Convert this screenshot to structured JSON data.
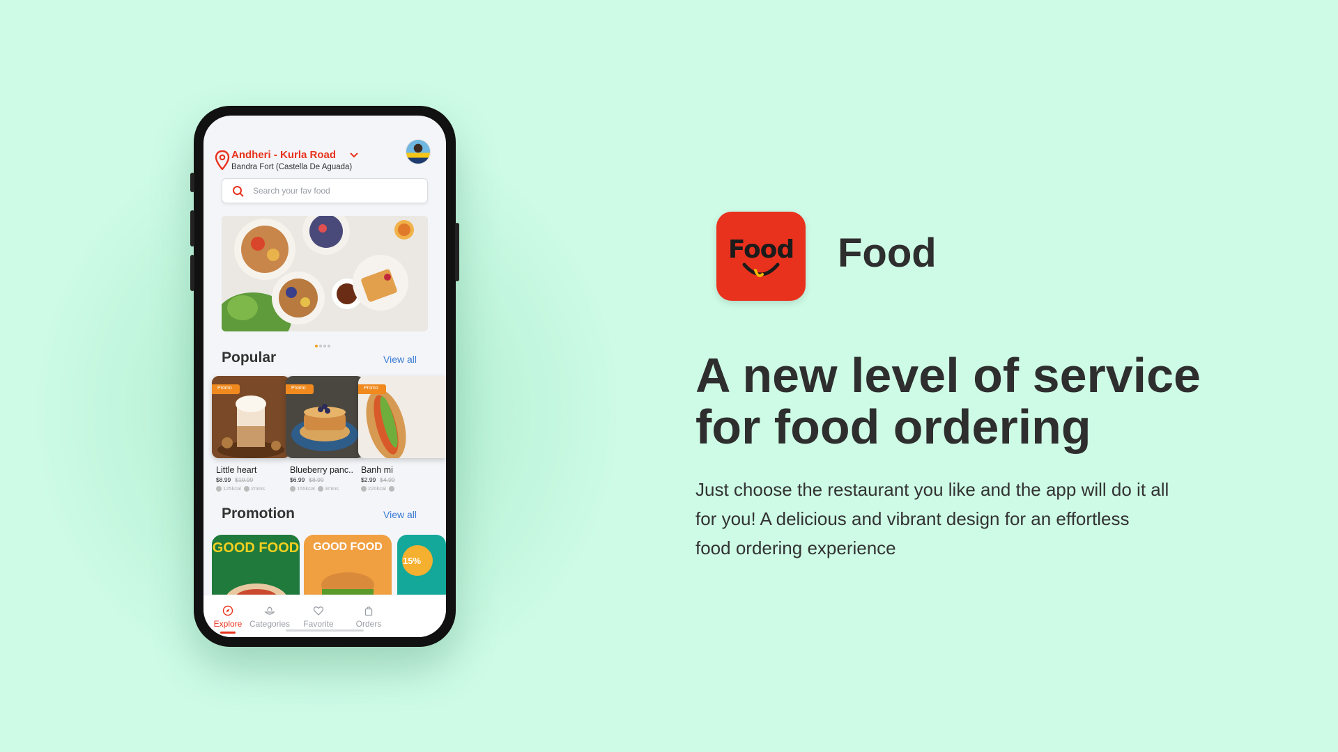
{
  "app": {
    "name": "Food",
    "icon_text": "Food",
    "headline": "A new level of service for food ordering",
    "description": "Just choose the restaurant you like and the app will do it all for you! A delicious and vibrant design for an effortless food ordering experience"
  },
  "phone": {
    "location": {
      "title": "Andheri - Kurla Road",
      "subtitle": "Bandra Fort (Castella De Aguada)"
    },
    "search": {
      "placeholder": "Search your fav food"
    },
    "popular": {
      "title": "Popular",
      "view_all": "View all",
      "items": [
        {
          "tag": "Promo",
          "name": "Little heart",
          "price": "$8.99",
          "old_price": "$10.99",
          "kcal": "125kcal",
          "time": "2mins"
        },
        {
          "tag": "Promo",
          "name": "Blueberry panc..",
          "price": "$6.99",
          "old_price": "$8.99",
          "kcal": "155kcal",
          "time": "3mins"
        },
        {
          "tag": "Promo",
          "name": "Banh mi",
          "price": "$2.99",
          "old_price": "$4.99",
          "kcal": "220kcal",
          "time": ""
        }
      ]
    },
    "promotion": {
      "title": "Promotion",
      "view_all": "View all",
      "cards": [
        {
          "text": "GOOD FOOD"
        },
        {
          "text": "GOOD FOOD"
        },
        {
          "text": "15%"
        }
      ]
    },
    "tabs": [
      {
        "label": "Explore"
      },
      {
        "label": "Categories"
      },
      {
        "label": "Favorite"
      },
      {
        "label": "Orders"
      }
    ]
  },
  "colors": {
    "background": "#cdfbe6",
    "brand_red": "#e8321e",
    "link_blue": "#3a7bd5",
    "promo_orange": "#f08a1e"
  }
}
